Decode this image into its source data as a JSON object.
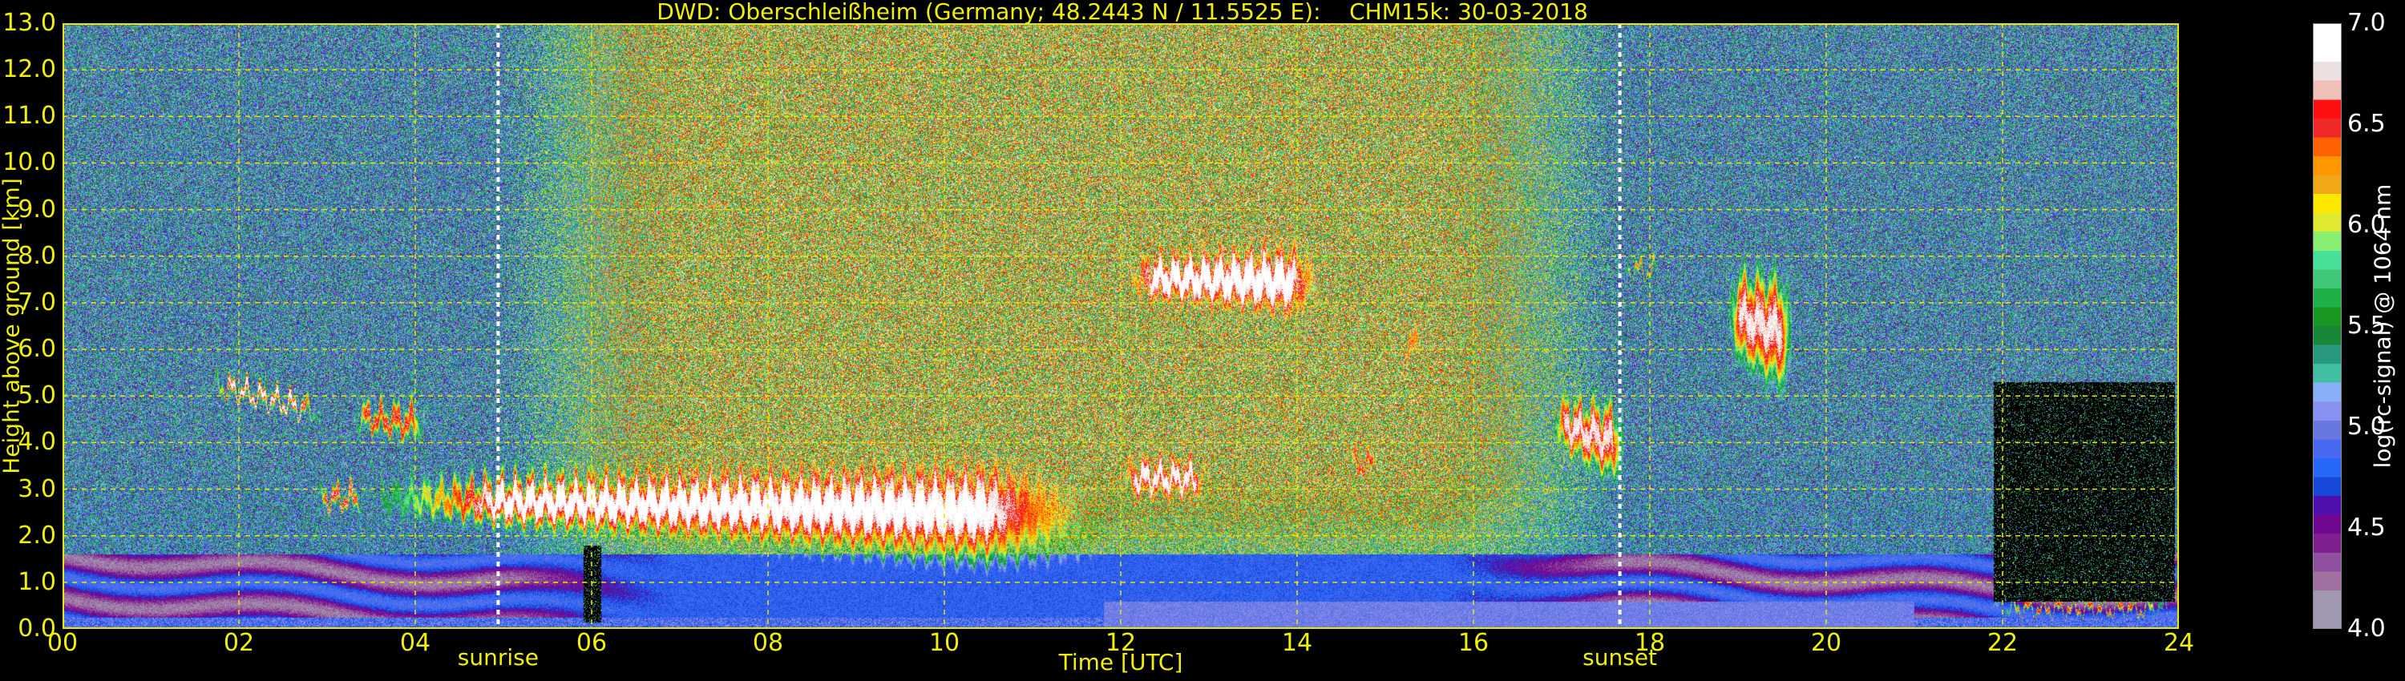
{
  "chart_data": {
    "type": "heatmap",
    "title": "DWD: Oberschleißheim (Germany; 48.2443 N / 11.5525 E):    CHM15k: 30-03-2018",
    "xlabel": "Time [UTC]",
    "ylabel": "Height above ground [km]",
    "xlim": [
      0,
      24
    ],
    "ylim": [
      0,
      13
    ],
    "x_ticks": [
      "00",
      "02",
      "04",
      "06",
      "08",
      "10",
      "12",
      "14",
      "16",
      "18",
      "20",
      "22",
      "24"
    ],
    "x_tick_values": [
      0,
      2,
      4,
      6,
      8,
      10,
      12,
      14,
      16,
      18,
      20,
      22,
      24
    ],
    "y_ticks": [
      "0.0",
      "1.0",
      "2.0",
      "3.0",
      "4.0",
      "5.0",
      "6.0",
      "7.0",
      "8.0",
      "9.0",
      "10.0",
      "11.0",
      "12.0",
      "13.0"
    ],
    "y_tick_values": [
      0,
      1,
      2,
      3,
      4,
      5,
      6,
      7,
      8,
      9,
      10,
      11,
      12,
      13
    ],
    "grid": true,
    "grid_color": "#e8e800",
    "annotations": [
      {
        "label": "sunrise",
        "x": 4.94
      },
      {
        "label": "sunset",
        "x": 17.66
      }
    ],
    "colorbar": {
      "label": "log(rc-signal) @ 1064 nm",
      "range": [
        4.0,
        7.0
      ],
      "ticks": [
        "4.0",
        "4.5",
        "5.0",
        "5.5",
        "6.0",
        "6.5",
        "7.0"
      ],
      "tick_values": [
        4.0,
        4.5,
        5.0,
        5.5,
        6.0,
        6.5,
        7.0
      ],
      "colors_low_to_high": [
        "#a098b0",
        "#a098b0",
        "#a070a0",
        "#9050a0",
        "#802090",
        "#700890",
        "#5010b0",
        "#1848d8",
        "#2868f8",
        "#4868f0",
        "#6878e0",
        "#8890f0",
        "#88b0f8",
        "#40c0a0",
        "#289880",
        "#188838",
        "#189820",
        "#20b048",
        "#40c878",
        "#48e098",
        "#88ee70",
        "#e0e830",
        "#ffe800",
        "#f0a818",
        "#ff9800",
        "#ff6000",
        "#f02828",
        "#ff1010",
        "#f0c0b8",
        "#ece0e0",
        "#ffffff",
        "#ffffff"
      ]
    },
    "features": [
      {
        "kind": "cloud",
        "t": [
          1.7,
          2.9
        ],
        "base": [
          5.1,
          4.5
        ],
        "top": [
          5.4,
          4.8
        ],
        "peak": 6.9
      },
      {
        "kind": "cloud",
        "t": [
          3.3,
          4.1
        ],
        "base": [
          4.3,
          4.0
        ],
        "top": [
          4.8,
          4.8
        ],
        "peak": 6.6
      },
      {
        "kind": "cloud",
        "t": [
          2.9,
          3.4
        ],
        "base": [
          2.6,
          2.6
        ],
        "top": [
          3.0,
          3.0
        ],
        "peak": 6.7
      },
      {
        "kind": "cloud",
        "t": [
          3.6,
          11.8
        ],
        "base": [
          2.4,
          1.2
        ],
        "top": [
          3.2,
          3.8
        ],
        "peak": 7.0
      },
      {
        "kind": "cloud",
        "t": [
          12.0,
          13.0
        ],
        "base": [
          2.8,
          2.8
        ],
        "top": [
          3.7,
          3.6
        ],
        "peak": 6.9
      },
      {
        "kind": "cloud",
        "t": [
          12.0,
          14.3
        ],
        "base": [
          7.1,
          6.5
        ],
        "top": [
          8.0,
          8.4
        ],
        "peak": 7.0
      },
      {
        "kind": "cloud",
        "t": [
          14.6,
          14.9
        ],
        "base": [
          3.3,
          3.3
        ],
        "top": [
          3.8,
          3.8
        ],
        "peak": 6.5
      },
      {
        "kind": "cloud",
        "t": [
          15.2,
          15.4
        ],
        "base": [
          5.7,
          5.7
        ],
        "top": [
          6.5,
          6.5
        ],
        "peak": 6.3
      },
      {
        "kind": "cloud",
        "t": [
          16.9,
          17.7
        ],
        "base": [
          3.9,
          3.0
        ],
        "top": [
          5.0,
          4.9
        ],
        "peak": 6.8
      },
      {
        "kind": "cloud",
        "t": [
          18.9,
          19.6
        ],
        "base": [
          5.8,
          4.9
        ],
        "top": [
          7.8,
          7.7
        ],
        "peak": 6.8
      },
      {
        "kind": "cloud",
        "t": [
          17.7,
          18.1
        ],
        "base": [
          7.6,
          7.6
        ],
        "top": [
          7.8,
          7.8
        ],
        "peak": 6.3
      },
      {
        "kind": "cloud",
        "t": [
          21.9,
          23.9
        ],
        "base": [
          0.35,
          0.35
        ],
        "top": [
          0.55,
          0.55
        ],
        "peak": 6.6
      },
      {
        "kind": "no_signal",
        "t": [
          5.9,
          6.1
        ],
        "z": [
          0.15,
          1.8
        ]
      },
      {
        "kind": "no_signal",
        "t": [
          21.9,
          23.95
        ],
        "z": [
          0.6,
          5.3
        ]
      }
    ]
  }
}
